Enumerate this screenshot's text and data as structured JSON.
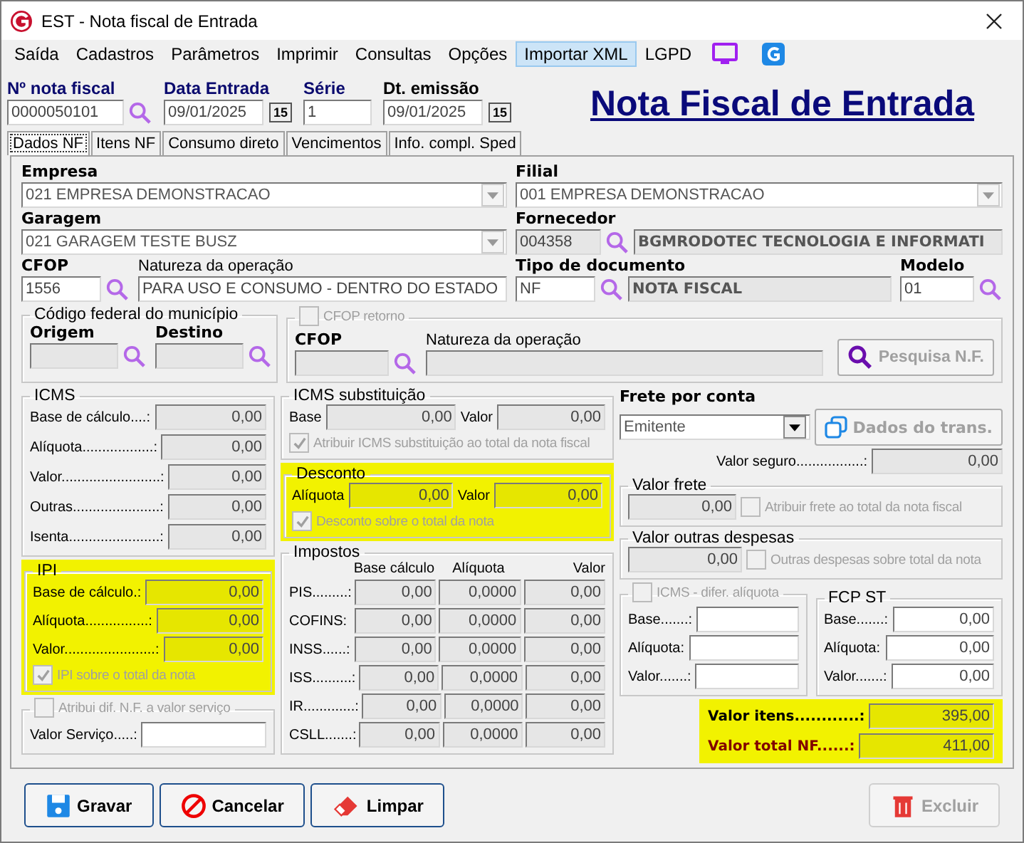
{
  "window": {
    "title": "EST - Nota fiscal de Entrada"
  },
  "menu": [
    {
      "label": "Saída",
      "selected": false
    },
    {
      "label": "Cadastros",
      "selected": false
    },
    {
      "label": "Parâmetros",
      "selected": false
    },
    {
      "label": "Imprimir",
      "selected": false
    },
    {
      "label": "Consultas",
      "selected": false
    },
    {
      "label": "Opções",
      "selected": false
    },
    {
      "label": "Importar XML",
      "selected": true
    },
    {
      "label": "LGPD",
      "selected": false
    }
  ],
  "header": {
    "nota_fiscal": {
      "label": "Nº nota fiscal",
      "value": "0000050101"
    },
    "data_entrada": {
      "label": "Data Entrada",
      "value": "09/01/2025",
      "calendar": "15"
    },
    "serie": {
      "label": "Série",
      "value": "1"
    },
    "dt_emissao": {
      "label": "Dt. emissão",
      "value": "09/01/2025",
      "calendar": "15"
    },
    "title": "Nota Fiscal de Entrada"
  },
  "tabs": [
    {
      "label": "Dados NF",
      "selected": true
    },
    {
      "label": "Itens NF",
      "selected": false
    },
    {
      "label": "Consumo direto",
      "selected": false
    },
    {
      "label": "Vencimentos",
      "selected": false
    },
    {
      "label": "Info. compl. Sped",
      "selected": false
    }
  ],
  "empresa": {
    "label": "Empresa",
    "value": "021 EMPRESA DEMONSTRACAO"
  },
  "filial": {
    "label": "Filial",
    "value": "001 EMPRESA DEMONSTRACAO"
  },
  "garagem": {
    "label": "Garagem",
    "value": "021 GARAGEM TESTE BUSZ"
  },
  "fornecedor": {
    "label": "Fornecedor",
    "code": "004358",
    "name": "BGMRODOTEC TECNOLOGIA E INFORMATI"
  },
  "cfop": {
    "label": "CFOP",
    "value": "1556"
  },
  "natureza": {
    "label": "Natureza da operação",
    "value": "PARA USO E CONSUMO - DENTRO DO ESTADO"
  },
  "tipo_documento": {
    "label": "Tipo de documento",
    "code": "NF",
    "name": "NOTA FISCAL"
  },
  "modelo": {
    "label": "Modelo",
    "value": "01"
  },
  "codigo_municipio": {
    "title": "Código federal do município",
    "origem": "Origem",
    "destino": "Destino"
  },
  "cfop_retorno": {
    "label": "CFOP retorno",
    "checked": false,
    "disabled": true,
    "cfop": "CFOP",
    "natureza": "Natureza da operação",
    "button": "Pesquisa N.F."
  },
  "icms": {
    "title": "ICMS",
    "rows": [
      {
        "label": "Base de cálculo....:",
        "value": "0,00"
      },
      {
        "label": "Alíquota..................:",
        "value": "0,00"
      },
      {
        "label": "Valor.........................:",
        "value": "0,00"
      },
      {
        "label": "Outras......................:",
        "value": "0,00"
      },
      {
        "label": "Isenta.......................:",
        "value": "0,00"
      }
    ]
  },
  "ipi": {
    "title": "IPI",
    "highlighted": true,
    "rows": [
      {
        "label": "Base de cálculo.:",
        "value": "0,00"
      },
      {
        "label": "Alíquota................:",
        "value": "0,00"
      },
      {
        "label": "Valor.......................:",
        "value": "0,00"
      }
    ],
    "checkbox": {
      "label": "IPI sobre o total da nota",
      "checked": true,
      "disabled": true
    }
  },
  "atribui": {
    "checkbox": {
      "label": "Atribui dif. N.F. a valor serviço",
      "checked": false,
      "disabled": true
    },
    "label": "Valor Serviço.....:"
  },
  "icms_st": {
    "title": "ICMS substituição",
    "base_label": "Base",
    "base": "0,00",
    "valor_label": "Valor",
    "valor": "0,00",
    "checkbox": {
      "label": "Atribuir ICMS substituição ao total da nota fiscal",
      "checked": true,
      "disabled": true
    }
  },
  "desconto": {
    "title": "Desconto",
    "highlighted": true,
    "aliquota_label": "Alíquota",
    "aliquota": "0,00",
    "valor_label": "Valor",
    "valor": "0,00",
    "checkbox": {
      "label": "Desconto sobre o total da nota",
      "checked": true,
      "disabled": true
    }
  },
  "impostos": {
    "title": "Impostos",
    "columns": [
      "Base cálculo",
      "Alíquota",
      "Valor"
    ],
    "rows": [
      {
        "label": "PIS.........:",
        "values": [
          "0,00",
          "0,0000",
          "0,00"
        ]
      },
      {
        "label": "COFINS:",
        "values": [
          "0,00",
          "0,0000",
          "0,00"
        ]
      },
      {
        "label": "INSS......:",
        "values": [
          "0,00",
          "0,0000",
          "0,00"
        ]
      },
      {
        "label": "ISS..........:",
        "values": [
          "0,00",
          "0,0000",
          "0,00"
        ]
      },
      {
        "label": "IR.............:",
        "values": [
          "0,00",
          "0,0000",
          "0,00"
        ]
      },
      {
        "label": "CSLL.......:",
        "values": [
          "0,00",
          "0,0000",
          "0,00"
        ]
      }
    ]
  },
  "frete": {
    "label": "Frete por conta",
    "value": "Emitente",
    "button": "Dados do trans.",
    "seguro_label": "Valor seguro.................:",
    "seguro": "0,00"
  },
  "valor_frete": {
    "title": "Valor frete",
    "value": "0,00",
    "checkbox": {
      "label": "Atribuir frete ao total da nota fiscal",
      "checked": false,
      "disabled": true
    }
  },
  "outras": {
    "title": "Valor outras despesas",
    "value": "0,00",
    "checkbox": {
      "label": "Outras despesas sobre total da nota",
      "checked": false,
      "disabled": true
    }
  },
  "icms_difer": {
    "checkbox": {
      "label": "ICMS - difer. alíquota",
      "checked": false,
      "disabled": true
    },
    "rows": [
      {
        "label": "Base.......:"
      },
      {
        "label": "Alíquota:"
      },
      {
        "label": "Valor.......:"
      }
    ]
  },
  "fcp_st": {
    "title": "FCP ST",
    "rows": [
      {
        "label": "Base.......:",
        "value": "0,00"
      },
      {
        "label": "Alíquota:",
        "value": "0,00"
      },
      {
        "label": "Valor.......:",
        "value": "0,00"
      }
    ]
  },
  "totals": {
    "highlighted": true,
    "rows": [
      {
        "label": "Valor itens............:",
        "value": "395,00",
        "kind": "plain"
      },
      {
        "label": "Valor total NF......:",
        "value": "411,00",
        "kind": "total"
      }
    ]
  },
  "buttons": [
    {
      "label": "Gravar",
      "kind": "save",
      "disabled": false
    },
    {
      "label": "Cancelar",
      "kind": "cancel",
      "disabled": false
    },
    {
      "label": "Limpar",
      "kind": "clear",
      "disabled": false
    },
    {
      "label": "Excluir",
      "kind": "delete",
      "disabled": true
    }
  ]
}
